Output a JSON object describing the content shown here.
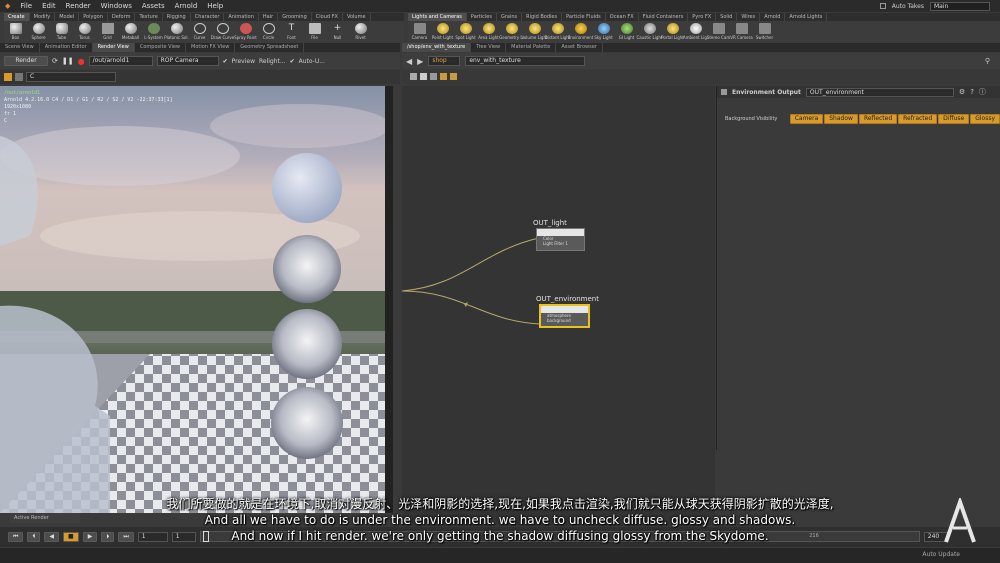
{
  "menu": [
    "File",
    "Edit",
    "Render",
    "Windows",
    "Assets",
    "Arnold",
    "Help"
  ],
  "auto_takes": "Auto Takes",
  "desktop": "Main",
  "shelf_tabs_left": [
    "Create",
    "Modify",
    "Model",
    "Polygon",
    "Deform",
    "Texture",
    "Rigging",
    "Character",
    "Animation",
    "Hair",
    "Grooming",
    "Cloud FX",
    "Volume"
  ],
  "shelf_tabs_right": [
    "Lights and Cameras",
    "Particles",
    "Grains",
    "Rigid Bodies",
    "Particle Fluids",
    "Ocean FX",
    "Fluid Containers",
    "Pyro FX",
    "Solid",
    "Wires",
    "Arnold",
    "Arnold Lights"
  ],
  "tools_left": [
    "Box",
    "Sphere",
    "Tube",
    "Torus",
    "Grid",
    "Metaball",
    "L-System",
    "Platonic Sol.",
    "Curve",
    "Draw Curve",
    "Spray Paint",
    "Circle",
    "Font",
    "File",
    "Null",
    "Rivet"
  ],
  "tools_right": [
    "Camera",
    "Point Light",
    "Spot Light",
    "Area Light",
    "Geometry L.",
    "Volume Light",
    "Distant Light",
    "Environment",
    "Sky Light",
    "GI Light",
    "Caustic Light",
    "Portal Light",
    "Ambient Lig.",
    "Stereo Cam",
    "VR Camera",
    "Switcher"
  ],
  "pane_tabs_left": [
    "Scene View",
    "Animation Editor",
    "Render View",
    "Composite View",
    "Motion FX View",
    "Geometry Spreadsheet"
  ],
  "pane_tabs_right": [
    "/shop/env_with_texture",
    "Tree View",
    "Material Palette",
    "Asset Browser"
  ],
  "render_toolbar": {
    "render_btn": "Render",
    "rop_path": "/out/arnold1",
    "camera": "ROP Camera",
    "preview": "Preview",
    "relight": "Relight...",
    "auto_update": "Auto-U..."
  },
  "render_channel": "C",
  "render_info": {
    "path": "/out/arnold1",
    "line1": "Arnold 4.2.16.0   C4 / D1 / G1 / R2 / S2 / V2 -22:37:33[1]",
    "resolution": "1920x1080",
    "frame": "fr 1",
    "channel": "C"
  },
  "network": {
    "context": "shop",
    "path": "env_with_texture",
    "nodes": [
      {
        "name": "OUT_light",
        "ports": [
          "Color",
          "Light Filter 1"
        ]
      },
      {
        "name": "OUT_environment",
        "ports": [
          "atmosphere",
          "background"
        ]
      }
    ]
  },
  "params": {
    "type": "Environment Output",
    "name": "OUT_environment",
    "visibility_label": "Background Visibility",
    "visibility_buttons": [
      "Camera",
      "Shadow",
      "Reflected",
      "Refracted",
      "Diffuse",
      "Glossy"
    ]
  },
  "timeline": {
    "frame": "1",
    "start": "1",
    "end": "240",
    "marker": "216",
    "tab": "Active Render"
  },
  "auto_update": "Auto Update",
  "subtitles": {
    "zh": "我们所要做的就是在环境下,取消对漫反射、光泽和阴影的选择,现在,如果我点击渲染,我们就只能从球天获得阴影扩散的光泽度,",
    "en1": "And all we have to do is under the environment. we have to uncheck diffuse. glossy and shadows.",
    "en2": "And now if I hit render. we're only getting the shadow diffusing glossy from the Skydome."
  },
  "colors": {
    "accent_orange": "#d89a2a",
    "node_selected": "#e8c21e",
    "panel": "#3a3a3a"
  }
}
